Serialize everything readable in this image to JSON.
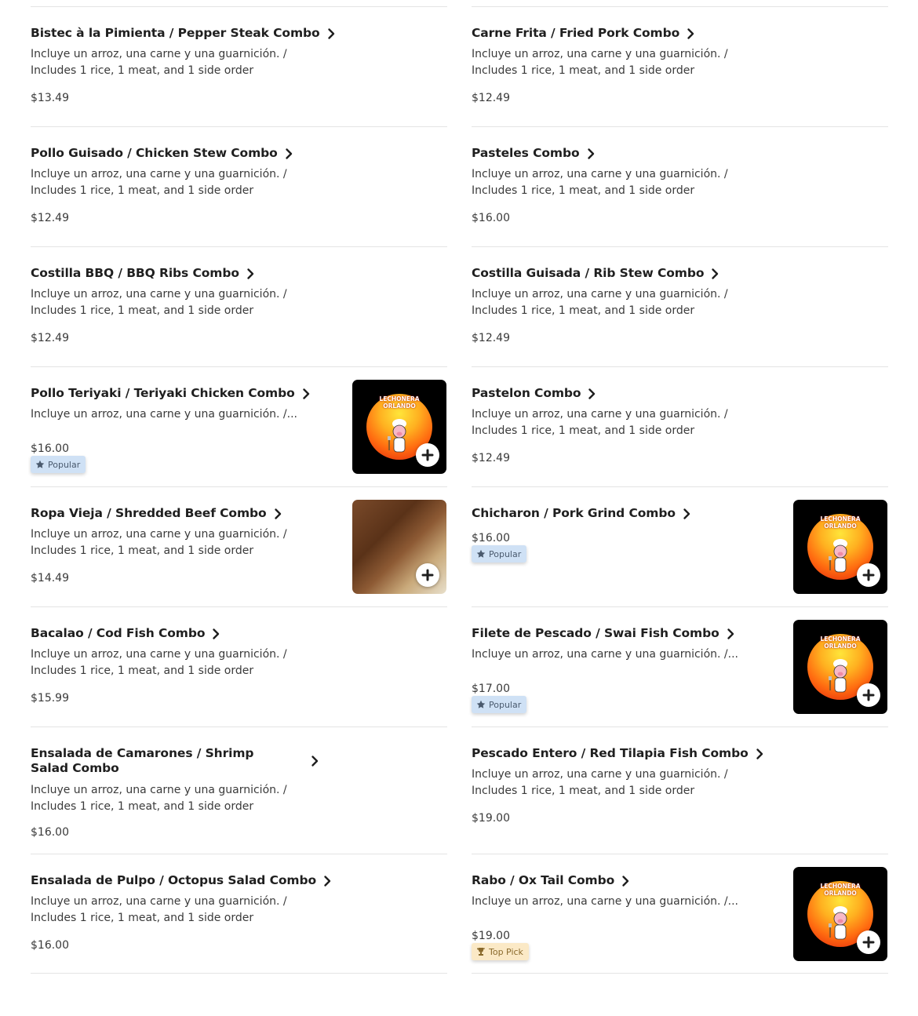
{
  "menu": {
    "left": [
      {
        "title": "Bistec à la Pimienta / Pepper Steak Combo",
        "desc": "Incluye un arroz, una carne y una guarnición. / Includes 1 rice, 1 meat, and 1 side order",
        "price": "$13.49"
      },
      {
        "title": "Pollo Guisado / Chicken Stew Combo",
        "desc": "Incluye un arroz, una carne y una guarnición. / Includes 1 rice, 1 meat, and 1 side order",
        "price": "$12.49"
      },
      {
        "title": "Costilla BBQ / BBQ Ribs Combo",
        "desc": "Incluye un arroz, una carne y una guarnición. / Includes 1 rice, 1 meat, and 1 side order",
        "price": "$12.49"
      },
      {
        "title": "Pollo Teriyaki / Teriyaki Chicken Combo",
        "desc": "Incluye un arroz, una carne y una guarnición. /...",
        "price": "$16.00",
        "badge": "Popular",
        "image": "logo"
      },
      {
        "title": "Ropa Vieja / Shredded Beef Combo",
        "desc": "Incluye un arroz, una carne y una guarnición. / Includes 1 rice, 1 meat, and 1 side order",
        "price": "$14.49",
        "image": "food"
      },
      {
        "title": "Bacalao / Cod Fish Combo",
        "desc": "Incluye un arroz, una carne y una guarnición. / Includes 1 rice, 1 meat, and 1 side order",
        "price": "$15.99"
      },
      {
        "title": "Ensalada de Camarones / Shrimp Salad Combo",
        "desc": "Incluye un arroz, una carne y una guarnición. / Includes 1 rice, 1 meat, and 1 side order",
        "price": "$16.00"
      },
      {
        "title": "Ensalada de Pulpo / Octopus Salad Combo",
        "desc": "Incluye un arroz, una carne y una guarnición. / Includes 1 rice, 1 meat, and 1 side order",
        "price": "$16.00"
      }
    ],
    "right": [
      {
        "title": "Carne Frita / Fried Pork Combo",
        "desc": "Incluye un arroz, una carne y una guarnición. / Includes 1 rice, 1 meat, and 1 side order",
        "price": "$12.49"
      },
      {
        "title": "Pasteles Combo",
        "desc": "Incluye un arroz, una carne y una guarnición. / Includes 1 rice, 1 meat, and 1 side order",
        "price": "$16.00"
      },
      {
        "title": "Costilla Guisada / Rib Stew Combo",
        "desc": "Incluye un arroz, una carne y una guarnición. / Includes 1 rice, 1 meat, and 1 side order",
        "price": "$12.49"
      },
      {
        "title": "Pastelon Combo",
        "desc": "Incluye un arroz, una carne y una guarnición. / Includes 1 rice, 1 meat, and 1 side order",
        "price": "$12.49"
      },
      {
        "title": "Chicharon / Pork Grind Combo",
        "desc": "",
        "price": "$16.00",
        "badge": "Popular",
        "image": "logo"
      },
      {
        "title": "Filete de Pescado / Swai Fish Combo",
        "desc": "Incluye un arroz, una carne y una guarnición. /...",
        "price": "$17.00",
        "badge": "Popular",
        "image": "logo"
      },
      {
        "title": "Pescado Entero / Red Tilapia Fish Combo",
        "desc": "Incluye un arroz, una carne y una guarnición. / Includes 1 rice, 1 meat, and 1 side order",
        "price": "$19.00"
      },
      {
        "title": "Rabo / Ox Tail Combo",
        "desc": "Incluye un arroz, una carne y una guarnición. /...",
        "price": "$19.00",
        "badge": "Top Pick",
        "image": "logo"
      }
    ]
  },
  "logo_text": {
    "line1": "LECHONERA",
    "line2": "ORLANDO"
  },
  "icons": {
    "chevron": "chevron-right-icon",
    "add": "plus-icon",
    "popular": "star-icon",
    "top_pick": "trophy-icon"
  },
  "colors": {
    "popular_bg": "#cfe1f5",
    "top_pick_bg": "#fbe9c6",
    "divider": "#e4e4e4"
  }
}
